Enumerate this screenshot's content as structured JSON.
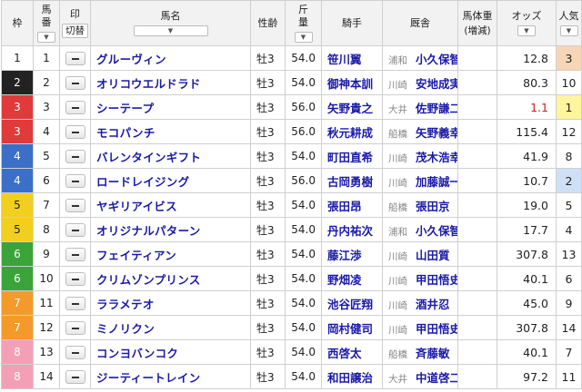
{
  "header": {
    "waku": "枠",
    "umaban_line1": "馬",
    "umaban_line2": "番",
    "mark": "印",
    "mark_toggle": "切替",
    "horse_name": "馬名",
    "sex_age": "性齢",
    "weight_line1": "斤",
    "weight_line2": "量",
    "jockey": "騎手",
    "trainer": "厩舎",
    "body_weight": "馬体重",
    "body_weight_sub": "(増減)",
    "odds": "オッズ",
    "popularity_line1": "人気",
    "sort_glyph": "▼"
  },
  "colors": {
    "accent_link": "#1a1aa8",
    "odds_favorite": "#d61a1a",
    "pop1_bg": "#fff59c",
    "pop2_bg": "#cfe0f6",
    "pop3_bg": "#f6d6b6"
  },
  "frame_colors": {
    "1": {
      "bg": "#ffffff",
      "fg": "#222222"
    },
    "2": {
      "bg": "#222222",
      "fg": "#ffffff"
    },
    "3": {
      "bg": "#e03a3a",
      "fg": "#ffffff"
    },
    "4": {
      "bg": "#3b6fc8",
      "fg": "#ffffff"
    },
    "5": {
      "bg": "#f2cf1f",
      "fg": "#222222"
    },
    "6": {
      "bg": "#3aa43a",
      "fg": "#ffffff"
    },
    "7": {
      "bg": "#f39a2b",
      "fg": "#ffffff"
    },
    "8": {
      "bg": "#f3a0b6",
      "fg": "#ffffff"
    }
  },
  "rows": [
    {
      "waku": "1",
      "umaban": "1",
      "name": "グルーヴィン",
      "sex_age": "牡3",
      "weight": "54.0",
      "jockey": "笹川翼",
      "loc": "浦和",
      "trainer": "小久保智",
      "odds": "12.8",
      "pop": "3"
    },
    {
      "waku": "2",
      "umaban": "2",
      "name": "オリコウエルドラド",
      "sex_age": "牡3",
      "weight": "54.0",
      "jockey": "御神本訓",
      "loc": "川崎",
      "trainer": "安地成実",
      "odds": "80.3",
      "pop": "10"
    },
    {
      "waku": "3",
      "umaban": "3",
      "name": "シーテープ",
      "sex_age": "牡3",
      "weight": "56.0",
      "jockey": "矢野貴之",
      "loc": "大井",
      "trainer": "佐野謙二",
      "odds": "1.1",
      "pop": "1"
    },
    {
      "waku": "3",
      "umaban": "4",
      "name": "モコパンチ",
      "sex_age": "牡3",
      "weight": "56.0",
      "jockey": "秋元耕成",
      "loc": "船橋",
      "trainer": "矢野義幸",
      "odds": "115.4",
      "pop": "12"
    },
    {
      "waku": "4",
      "umaban": "5",
      "name": "バレンタインギフト",
      "sex_age": "牡3",
      "weight": "54.0",
      "jockey": "町田直希",
      "loc": "川崎",
      "trainer": "茂木浩幸",
      "odds": "41.9",
      "pop": "8"
    },
    {
      "waku": "4",
      "umaban": "6",
      "name": "ロードレイジング",
      "sex_age": "牡3",
      "weight": "56.0",
      "jockey": "古岡勇樹",
      "loc": "川崎",
      "trainer": "加藤誠一",
      "odds": "10.7",
      "pop": "2"
    },
    {
      "waku": "5",
      "umaban": "7",
      "name": "ヤギリアイビス",
      "sex_age": "牡3",
      "weight": "54.0",
      "jockey": "張田昂",
      "loc": "船橋",
      "trainer": "張田京",
      "odds": "19.0",
      "pop": "5"
    },
    {
      "waku": "5",
      "umaban": "8",
      "name": "オリジナルパターン",
      "sex_age": "牡3",
      "weight": "54.0",
      "jockey": "丹内祐次",
      "loc": "浦和",
      "trainer": "小久保智",
      "odds": "17.7",
      "pop": "4"
    },
    {
      "waku": "6",
      "umaban": "9",
      "name": "フェイティアン",
      "sex_age": "牡3",
      "weight": "54.0",
      "jockey": "藤江渉",
      "loc": "川崎",
      "trainer": "山田質",
      "odds": "307.8",
      "pop": "13"
    },
    {
      "waku": "6",
      "umaban": "10",
      "name": "クリムゾンプリンス",
      "sex_age": "牡3",
      "weight": "54.0",
      "jockey": "野畑凌",
      "loc": "川崎",
      "trainer": "甲田悟史",
      "odds": "40.1",
      "pop": "6"
    },
    {
      "waku": "7",
      "umaban": "11",
      "name": "ララメテオ",
      "sex_age": "牡3",
      "weight": "54.0",
      "jockey": "池谷匠翔",
      "loc": "川崎",
      "trainer": "酒井忍",
      "odds": "45.0",
      "pop": "9"
    },
    {
      "waku": "7",
      "umaban": "12",
      "name": "ミノリクン",
      "sex_age": "牡3",
      "weight": "54.0",
      "jockey": "岡村健司",
      "loc": "川崎",
      "trainer": "甲田悟史",
      "odds": "307.8",
      "pop": "14"
    },
    {
      "waku": "8",
      "umaban": "13",
      "name": "コンヨバンコク",
      "sex_age": "牡3",
      "weight": "54.0",
      "jockey": "西啓太",
      "loc": "船橋",
      "trainer": "斉藤敏",
      "odds": "40.1",
      "pop": "7"
    },
    {
      "waku": "8",
      "umaban": "14",
      "name": "ジーティートレイン",
      "sex_age": "牡3",
      "weight": "54.0",
      "jockey": "和田譲治",
      "loc": "大井",
      "trainer": "中道啓二",
      "odds": "97.2",
      "pop": "11"
    }
  ]
}
